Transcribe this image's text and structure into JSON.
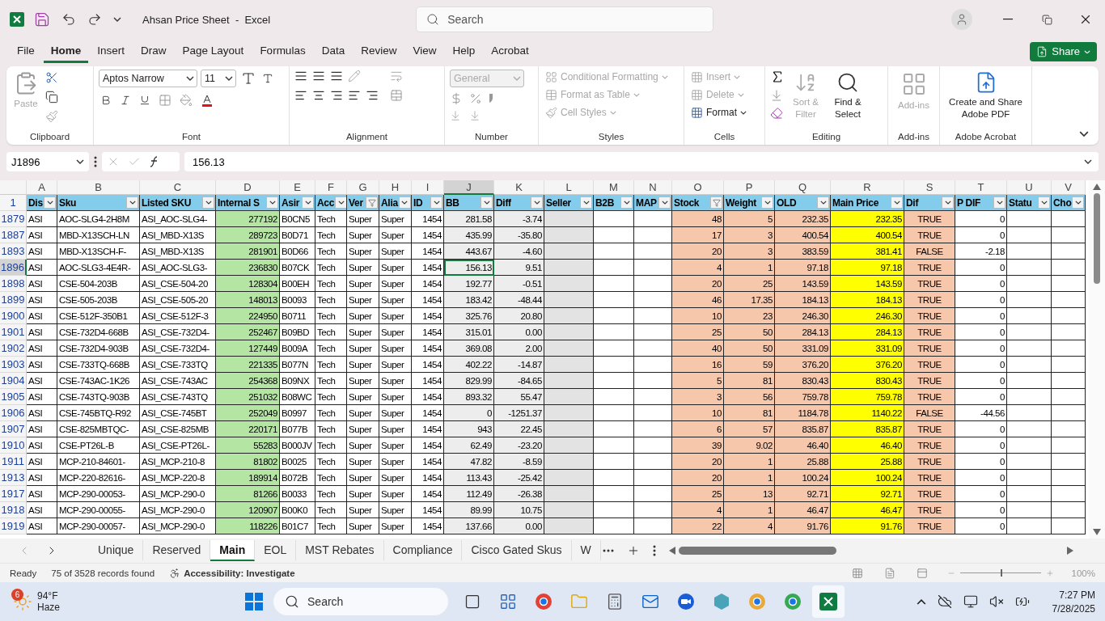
{
  "window": {
    "title": "Ahsan Price Sheet  -  Excel",
    "search": {
      "placeholder": "Search"
    }
  },
  "menu_tabs": [
    {
      "label": "File",
      "selected": false
    },
    {
      "label": "Home",
      "selected": true
    },
    {
      "label": "Insert",
      "selected": false
    },
    {
      "label": "Draw",
      "selected": false
    },
    {
      "label": "Page Layout",
      "selected": false
    },
    {
      "label": "Formulas",
      "selected": false
    },
    {
      "label": "Data",
      "selected": false
    },
    {
      "label": "Review",
      "selected": false
    },
    {
      "label": "View",
      "selected": false
    },
    {
      "label": "Help",
      "selected": false
    },
    {
      "label": "Acrobat",
      "selected": false
    }
  ],
  "share_button": "Share",
  "ribbon": {
    "groups": [
      {
        "kind": "clipboard",
        "label": "Clipboard",
        "items": [
          {
            "label": "Paste",
            "disabled": true
          }
        ]
      },
      {
        "kind": "font",
        "label": "Font",
        "font_name": "Aptos Narrow",
        "font_size": "11"
      },
      {
        "kind": "alignment",
        "label": "Alignment"
      },
      {
        "kind": "number",
        "label": "Number",
        "items": [
          {
            "label": "General",
            "disabled": true
          }
        ]
      },
      {
        "kind": "styles",
        "label": "Styles",
        "items": [
          {
            "label": "Conditional Formatting",
            "disabled": true
          },
          {
            "label": "Format as Table",
            "disabled": true
          },
          {
            "label": "Cell Styles",
            "disabled": true
          }
        ]
      },
      {
        "kind": "cells",
        "label": "Cells",
        "items": [
          {
            "label": "Insert",
            "disabled": true
          },
          {
            "label": "Delete",
            "disabled": true
          },
          {
            "label": "Format",
            "disabled": false
          }
        ]
      },
      {
        "kind": "editing",
        "label": "Editing",
        "items": [
          {
            "label": "Sort & Filter",
            "disabled": true
          },
          {
            "label": "Find & Select",
            "disabled": false
          }
        ]
      },
      {
        "kind": "addins",
        "label": "Add-ins",
        "items": [
          {
            "label": "Add-ins",
            "disabled": true
          }
        ]
      },
      {
        "kind": "acrobat",
        "label": "Adobe Acrobat",
        "items": [
          {
            "label": "Create and Share Adobe PDF",
            "disabled": false
          }
        ]
      }
    ]
  },
  "formula_bar": {
    "name_box": "J1896",
    "value": "156.13"
  },
  "sheet": {
    "columns": [
      {
        "letter": "A",
        "header": "Dis",
        "kind": "text",
        "filtered": false,
        "selected": false
      },
      {
        "letter": "B",
        "header": "Sku",
        "kind": "text",
        "filtered": false,
        "selected": false
      },
      {
        "letter": "C",
        "header": "Listed SKU",
        "kind": "text",
        "filtered": false,
        "selected": false
      },
      {
        "letter": "D",
        "header": "Internal S",
        "kind": "number",
        "filtered": false,
        "selected": false,
        "color": "#b4e5a2"
      },
      {
        "letter": "E",
        "header": "Asir",
        "kind": "text",
        "filtered": false,
        "selected": false
      },
      {
        "letter": "F",
        "header": "Acc",
        "kind": "text",
        "filtered": false,
        "selected": false
      },
      {
        "letter": "G",
        "header": "Ver",
        "kind": "text",
        "filtered": true,
        "selected": false
      },
      {
        "letter": "H",
        "header": "Alia",
        "kind": "text",
        "filtered": false,
        "selected": false
      },
      {
        "letter": "I",
        "header": "ID",
        "kind": "number",
        "filtered": false,
        "selected": false
      },
      {
        "letter": "J",
        "header": "BB",
        "kind": "number",
        "filtered": false,
        "selected": true,
        "color": "#ededed"
      },
      {
        "letter": "K",
        "header": "Diff",
        "kind": "number",
        "filtered": false,
        "selected": false,
        "color": "#ededed"
      },
      {
        "letter": "L",
        "header": "Seller",
        "kind": "text",
        "filtered": false,
        "selected": false,
        "color": "#e3e3e3"
      },
      {
        "letter": "M",
        "header": "B2B",
        "kind": "text",
        "filtered": false,
        "selected": false
      },
      {
        "letter": "N",
        "header": "MAP",
        "kind": "text",
        "filtered": false,
        "selected": false
      },
      {
        "letter": "O",
        "header": "Stock",
        "kind": "number",
        "filtered": true,
        "selected": false,
        "color": "#f7c7ac"
      },
      {
        "letter": "P",
        "header": "Weight",
        "kind": "number",
        "filtered": false,
        "selected": false,
        "color": "#f7c7ac"
      },
      {
        "letter": "Q",
        "header": "OLD",
        "kind": "number",
        "filtered": false,
        "selected": false,
        "color": "#f7c7ac"
      },
      {
        "letter": "R",
        "header": "Main Price",
        "kind": "number",
        "filtered": false,
        "selected": false,
        "color": "#ffff00"
      },
      {
        "letter": "S",
        "header": "Dif",
        "kind": "boolean",
        "filtered": false,
        "selected": false,
        "color": "#f7c7ac"
      },
      {
        "letter": "T",
        "header": "P DIF",
        "kind": "number",
        "filtered": false,
        "selected": false
      },
      {
        "letter": "U",
        "header": "Statu",
        "kind": "text",
        "filtered": false,
        "selected": false
      },
      {
        "letter": "V",
        "header": "Cho",
        "kind": "text",
        "filtered": false,
        "selected": false
      }
    ],
    "header_row_number": "1",
    "rows": [
      {
        "number": "1879",
        "selected": false,
        "cells": {
          "A": "ASI",
          "B": "AOC-SLG4-2H8M",
          "C": "ASI_AOC-SLG4-",
          "D": "277192",
          "E": "B0CN5",
          "F": "Tech",
          "G": "Super",
          "H": "Super",
          "I": "1454",
          "J": "281.58",
          "K": "-3.74",
          "O": "48",
          "P": "5",
          "Q": "232.35",
          "R": "232.35",
          "S": "TRUE",
          "T": "0"
        }
      },
      {
        "number": "1887",
        "selected": false,
        "cells": {
          "A": "ASI",
          "B": "MBD-X13SCH-LN",
          "C": "ASI_MBD-X13S",
          "D": "289723",
          "E": "B0D71",
          "F": "Tech",
          "G": "Super",
          "H": "Super",
          "I": "1454",
          "J": "435.99",
          "K": "-35.80",
          "O": "17",
          "P": "3",
          "Q": "400.54",
          "R": "400.54",
          "S": "TRUE",
          "T": "0"
        }
      },
      {
        "number": "1893",
        "selected": false,
        "cells": {
          "A": "ASI",
          "B": "MBD-X13SCH-F-",
          "C": "ASI_MBD-X13S",
          "D": "281901",
          "E": "B0D66",
          "F": "Tech",
          "G": "Super",
          "H": "Super",
          "I": "1454",
          "J": "443.67",
          "K": "-4.60",
          "O": "20",
          "P": "3",
          "Q": "383.59",
          "R": "381.41",
          "S": "FALSE",
          "T": "-2.18"
        }
      },
      {
        "number": "1896",
        "selected": true,
        "cells": {
          "A": "ASI",
          "B": "AOC-SLG3-4E4R-",
          "C": "ASI_AOC-SLG3-",
          "D": "236830",
          "E": "B07CK",
          "F": "Tech",
          "G": "Super",
          "H": "Super",
          "I": "1454",
          "J": "156.13",
          "K": "9.51",
          "O": "4",
          "P": "1",
          "Q": "97.18",
          "R": "97.18",
          "S": "TRUE",
          "T": "0"
        }
      },
      {
        "number": "1898",
        "selected": false,
        "cells": {
          "A": "ASI",
          "B": "CSE-504-203B",
          "C": "ASI_CSE-504-20",
          "D": "128304",
          "E": "B00EH",
          "F": "Tech",
          "G": "Super",
          "H": "Super",
          "I": "1454",
          "J": "192.77",
          "K": "-0.51",
          "O": "20",
          "P": "25",
          "Q": "143.59",
          "R": "143.59",
          "S": "TRUE",
          "T": "0"
        }
      },
      {
        "number": "1899",
        "selected": false,
        "cells": {
          "A": "ASI",
          "B": "CSE-505-203B",
          "C": "ASI_CSE-505-20",
          "D": "148013",
          "E": "B0093",
          "F": "Tech",
          "G": "Super",
          "H": "Super",
          "I": "1454",
          "J": "183.42",
          "K": "-48.44",
          "O": "46",
          "P": "17.35",
          "Q": "184.13",
          "R": "184.13",
          "S": "TRUE",
          "T": "0"
        }
      },
      {
        "number": "1900",
        "selected": false,
        "cells": {
          "A": "ASI",
          "B": "CSE-512F-350B1",
          "C": "ASI_CSE-512F-3",
          "D": "224950",
          "E": "B0711",
          "F": "Tech",
          "G": "Super",
          "H": "Super",
          "I": "1454",
          "J": "325.76",
          "K": "20.80",
          "O": "10",
          "P": "23",
          "Q": "246.30",
          "R": "246.30",
          "S": "TRUE",
          "T": "0"
        }
      },
      {
        "number": "1901",
        "selected": false,
        "cells": {
          "A": "ASI",
          "B": "CSE-732D4-668B",
          "C": "ASI_CSE-732D4-",
          "D": "252467",
          "E": "B09BD",
          "F": "Tech",
          "G": "Super",
          "H": "Super",
          "I": "1454",
          "J": "315.01",
          "K": "0.00",
          "O": "25",
          "P": "50",
          "Q": "284.13",
          "R": "284.13",
          "S": "TRUE",
          "T": "0"
        }
      },
      {
        "number": "1902",
        "selected": false,
        "cells": {
          "A": "ASI",
          "B": "CSE-732D4-903B",
          "C": "ASI_CSE-732D4-",
          "D": "127449",
          "E": "B009A",
          "F": "Tech",
          "G": "Super",
          "H": "Super",
          "I": "1454",
          "J": "369.08",
          "K": "2.00",
          "O": "40",
          "P": "50",
          "Q": "331.09",
          "R": "331.09",
          "S": "TRUE",
          "T": "0"
        }
      },
      {
        "number": "1903",
        "selected": false,
        "cells": {
          "A": "ASI",
          "B": "CSE-733TQ-668B",
          "C": "ASI_CSE-733TQ",
          "D": "221335",
          "E": "B077N",
          "F": "Tech",
          "G": "Super",
          "H": "Super",
          "I": "1454",
          "J": "402.22",
          "K": "-14.87",
          "O": "16",
          "P": "59",
          "Q": "376.20",
          "R": "376.20",
          "S": "TRUE",
          "T": "0"
        }
      },
      {
        "number": "1904",
        "selected": false,
        "cells": {
          "A": "ASI",
          "B": "CSE-743AC-1K26",
          "C": "ASI_CSE-743AC",
          "D": "254368",
          "E": "B09NX",
          "F": "Tech",
          "G": "Super",
          "H": "Super",
          "I": "1454",
          "J": "829.99",
          "K": "-84.65",
          "O": "5",
          "P": "81",
          "Q": "830.43",
          "R": "830.43",
          "S": "TRUE",
          "T": "0"
        }
      },
      {
        "number": "1905",
        "selected": false,
        "cells": {
          "A": "ASI",
          "B": "CSE-743TQ-903B",
          "C": "ASI_CSE-743TQ",
          "D": "251032",
          "E": "B08WC",
          "F": "Tech",
          "G": "Super",
          "H": "Super",
          "I": "1454",
          "J": "893.32",
          "K": "55.47",
          "O": "3",
          "P": "56",
          "Q": "759.78",
          "R": "759.78",
          "S": "TRUE",
          "T": "0"
        }
      },
      {
        "number": "1906",
        "selected": false,
        "cells": {
          "A": "ASI",
          "B": "CSE-745BTQ-R92",
          "C": "ASI_CSE-745BT",
          "D": "252049",
          "E": "B0997",
          "F": "Tech",
          "G": "Super",
          "H": "Super",
          "I": "1454",
          "J": "0",
          "K": "-1251.37",
          "O": "10",
          "P": "81",
          "Q": "1184.78",
          "R": "1140.22",
          "S": "FALSE",
          "T": "-44.56"
        }
      },
      {
        "number": "1907",
        "selected": false,
        "cells": {
          "A": "ASI",
          "B": "CSE-825MBTQC-",
          "C": "ASI_CSE-825MB",
          "D": "220171",
          "E": "B077B",
          "F": "Tech",
          "G": "Super",
          "H": "Super",
          "I": "1454",
          "J": "943",
          "K": "22.45",
          "O": "6",
          "P": "57",
          "Q": "835.87",
          "R": "835.87",
          "S": "TRUE",
          "T": "0"
        }
      },
      {
        "number": "1910",
        "selected": false,
        "cells": {
          "A": "ASI",
          "B": "CSE-PT26L-B",
          "C": "ASI_CSE-PT26L-",
          "D": "55283",
          "E": "B000JV",
          "F": "Tech",
          "G": "Super",
          "H": "Super",
          "I": "1454",
          "J": "62.49",
          "K": "-23.20",
          "O": "39",
          "P": "9.02",
          "Q": "46.40",
          "R": "46.40",
          "S": "TRUE",
          "T": "0"
        }
      },
      {
        "number": "1911",
        "selected": false,
        "cells": {
          "A": "ASI",
          "B": "MCP-210-84601-",
          "C": "ASI_MCP-210-8",
          "D": "81802",
          "E": "B0025",
          "F": "Tech",
          "G": "Super",
          "H": "Super",
          "I": "1454",
          "J": "47.82",
          "K": "-8.59",
          "O": "20",
          "P": "1",
          "Q": "25.88",
          "R": "25.88",
          "S": "TRUE",
          "T": "0"
        }
      },
      {
        "number": "1913",
        "selected": false,
        "cells": {
          "A": "ASI",
          "B": "MCP-220-82616-",
          "C": "ASI_MCP-220-8",
          "D": "189914",
          "E": "B072B",
          "F": "Tech",
          "G": "Super",
          "H": "Super",
          "I": "1454",
          "J": "113.43",
          "K": "-25.42",
          "O": "20",
          "P": "1",
          "Q": "100.24",
          "R": "100.24",
          "S": "TRUE",
          "T": "0"
        }
      },
      {
        "number": "1917",
        "selected": false,
        "cells": {
          "A": "ASI",
          "B": "MCP-290-00053-",
          "C": "ASI_MCP-290-0",
          "D": "81266",
          "E": "B0033",
          "F": "Tech",
          "G": "Super",
          "H": "Super",
          "I": "1454",
          "J": "112.49",
          "K": "-26.38",
          "O": "25",
          "P": "13",
          "Q": "92.71",
          "R": "92.71",
          "S": "TRUE",
          "T": "0"
        }
      },
      {
        "number": "1918",
        "selected": false,
        "cells": {
          "A": "ASI",
          "B": "MCP-290-00055-",
          "C": "ASI_MCP-290-0",
          "D": "120907",
          "E": "B00K0",
          "F": "Tech",
          "G": "Super",
          "H": "Super",
          "I": "1454",
          "J": "89.99",
          "K": "10.75",
          "O": "4",
          "P": "1",
          "Q": "46.47",
          "R": "46.47",
          "S": "TRUE",
          "T": "0"
        }
      },
      {
        "number": "1919",
        "selected": false,
        "cells": {
          "A": "ASI",
          "B": "MCP-290-00057-",
          "C": "ASI_MCP-290-0",
          "D": "118226",
          "E": "B01C7",
          "F": "Tech",
          "G": "Super",
          "H": "Super",
          "I": "1454",
          "J": "137.66",
          "K": "0.00",
          "O": "22",
          "P": "4",
          "Q": "91.76",
          "R": "91.76",
          "S": "TRUE",
          "T": "0"
        }
      }
    ]
  },
  "sheet_tabs": [
    {
      "label": "Unique",
      "selected": false
    },
    {
      "label": "Reserved",
      "selected": false
    },
    {
      "label": "Main",
      "selected": true
    },
    {
      "label": "EOL",
      "selected": false
    },
    {
      "label": "MST Rebates",
      "selected": false
    },
    {
      "label": "Compliance",
      "selected": false
    },
    {
      "label": "Cisco Gated Skus",
      "selected": false
    },
    {
      "label": "W",
      "selected": false
    }
  ],
  "status_bar": {
    "mode": "Ready",
    "records": "75 of 3528 records found",
    "accessibility": "Accessibility: Investigate",
    "zoom": {
      "level": 0.5,
      "reading": "100%"
    }
  },
  "taskbar": {
    "weather": {
      "badge": "6",
      "temperature": "94°F",
      "condition": "Haze"
    },
    "search": {
      "placeholder": "Search"
    },
    "time": "7:27 PM",
    "date": "7/28/2025"
  }
}
